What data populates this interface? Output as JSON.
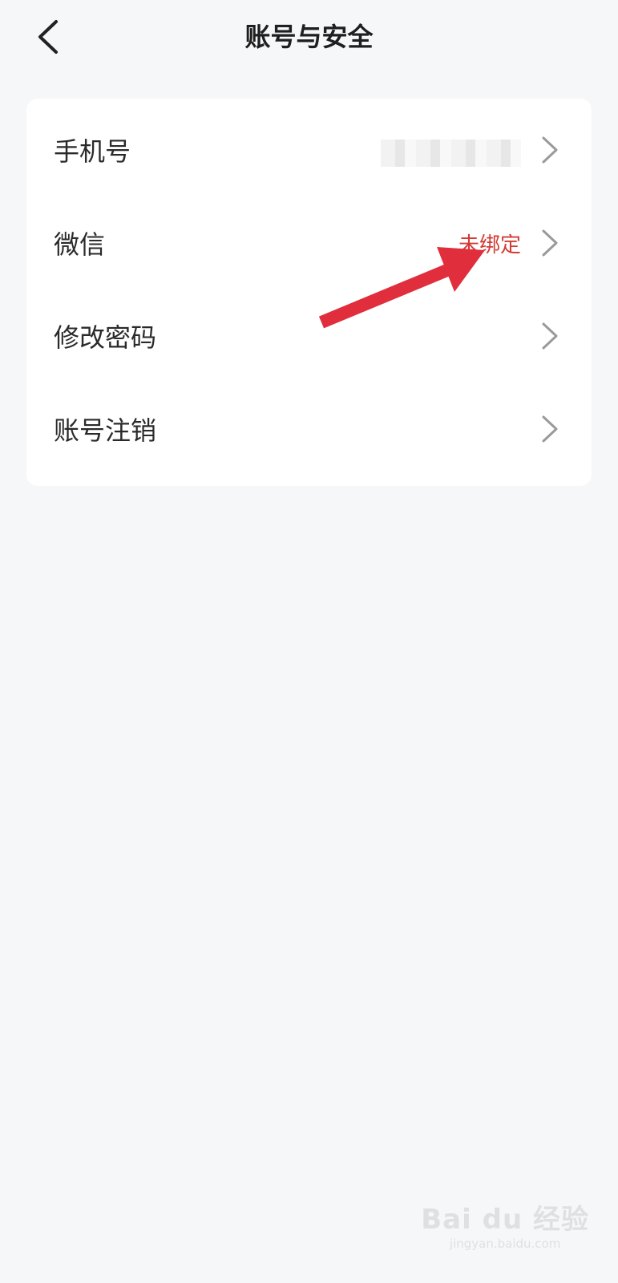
{
  "header": {
    "title": "账号与安全",
    "back_icon": "chevron-left-icon"
  },
  "rows": [
    {
      "label": "手机号",
      "value": "",
      "value_masked": true
    },
    {
      "label": "微信",
      "value": "未绑定",
      "value_color": "#d23b36"
    },
    {
      "label": "修改密码",
      "value": ""
    },
    {
      "label": "账号注销",
      "value": ""
    }
  ],
  "colors": {
    "background": "#f6f7f9",
    "card": "#ffffff",
    "accent_red": "#d23b36",
    "arrow_annotation": "#e02e3c",
    "chevron": "#9a9a9a"
  },
  "watermark": {
    "brand": "Bai du 经验",
    "site": "jingyan.baidu.com"
  }
}
